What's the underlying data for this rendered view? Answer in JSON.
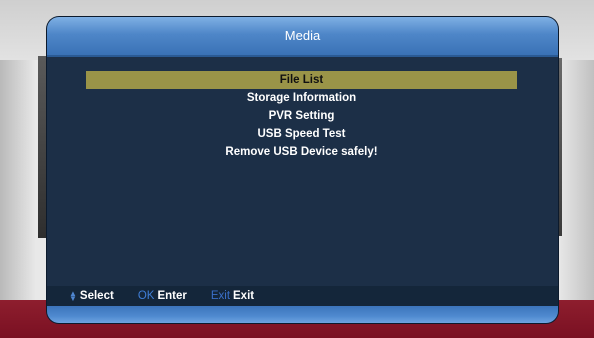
{
  "dialog": {
    "title": "Media"
  },
  "menu": {
    "items": [
      {
        "label": "File List",
        "selected": true
      },
      {
        "label": "Storage Information",
        "selected": false
      },
      {
        "label": "PVR Setting",
        "selected": false
      },
      {
        "label": "USB Speed Test",
        "selected": false
      },
      {
        "label": "Remove USB Device safely!",
        "selected": false
      }
    ]
  },
  "help": {
    "select": {
      "key_icon": "up-down-arrows-icon",
      "label": "Select"
    },
    "ok": {
      "key": "OK",
      "label": "Enter"
    },
    "exit": {
      "key": "Exit",
      "label": "Exit"
    }
  },
  "colors": {
    "highlight": "#9a9448",
    "panel": "#1c2f47",
    "title_bar": "#4e86c8",
    "bottom_band": "#8e1e2e"
  }
}
